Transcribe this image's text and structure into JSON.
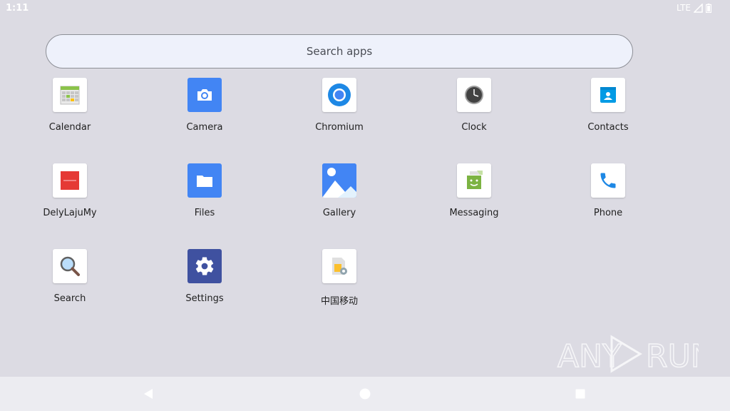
{
  "status_bar": {
    "time": "1:11",
    "network": "LTE",
    "icons": [
      "signal-icon",
      "battery-icon"
    ]
  },
  "search": {
    "placeholder": "Search apps"
  },
  "apps": [
    {
      "label": "Calendar",
      "icon": "calendar-icon"
    },
    {
      "label": "Camera",
      "icon": "camera-icon"
    },
    {
      "label": "Chromium",
      "icon": "chromium-icon"
    },
    {
      "label": "Clock",
      "icon": "clock-icon"
    },
    {
      "label": "Contacts",
      "icon": "contacts-icon"
    },
    {
      "label": "DelyLajuMy",
      "icon": "delylajumy-icon"
    },
    {
      "label": "Files",
      "icon": "folder-icon"
    },
    {
      "label": "Gallery",
      "icon": "gallery-icon"
    },
    {
      "label": "Messaging",
      "icon": "messaging-icon"
    },
    {
      "label": "Phone",
      "icon": "phone-icon"
    },
    {
      "label": "Search",
      "icon": "magnifier-icon"
    },
    {
      "label": "Settings",
      "icon": "gear-icon"
    },
    {
      "label": "中国移动",
      "icon": "sim-settings-icon"
    }
  ],
  "watermark": {
    "text_left": "ANY",
    "text_right": "RUN"
  },
  "nav_bar": {
    "buttons": [
      "back-icon",
      "home-icon",
      "recents-icon"
    ]
  },
  "colors": {
    "background": "#dcdbe3",
    "nav_bar": "#ececf1",
    "search_fill": "#eef1fb",
    "accent_blue": "#4285f4"
  }
}
